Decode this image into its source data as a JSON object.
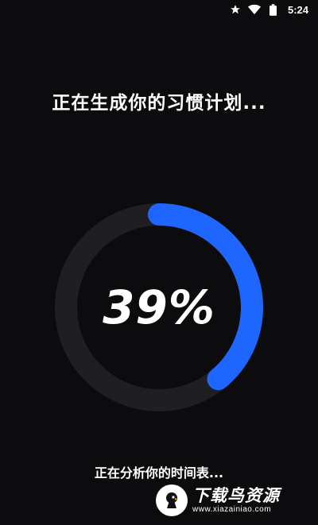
{
  "status_bar": {
    "icons": [
      "star-icon",
      "wifi-icon",
      "battery-icon"
    ],
    "time": "5:24"
  },
  "heading": "正在生成你的习惯计划...",
  "progress": {
    "value": 39,
    "label": "39%",
    "accent_color": "#1f66ff",
    "track_color": "#1f1f21"
  },
  "analysis_text": "正在分析你的时间表...",
  "watermark": {
    "name": "下载鸟资源",
    "url": "www.xiazainiao.com"
  }
}
